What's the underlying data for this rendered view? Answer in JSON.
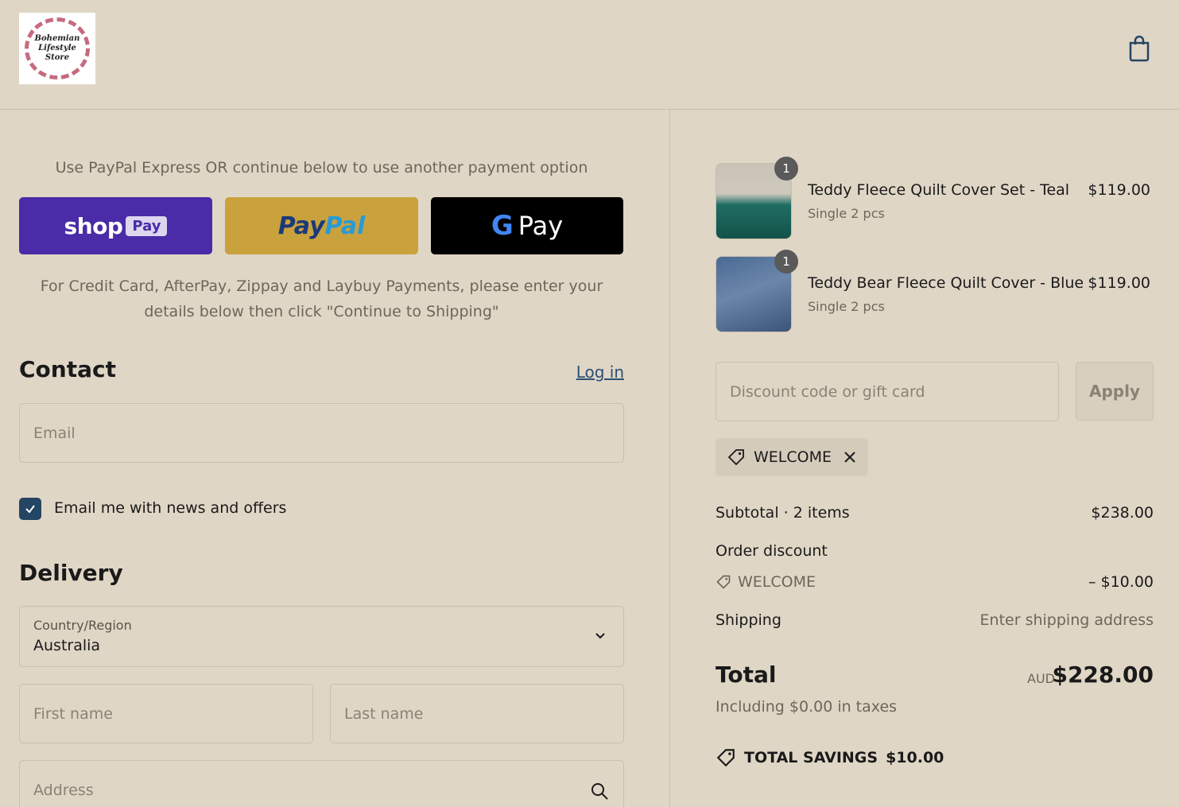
{
  "store": {
    "logo_text": "Bohemian Lifestyle Store"
  },
  "express": {
    "note": "Use PayPal Express OR continue below to use another payment option",
    "shop_word": "shop",
    "shop_pay": "Pay",
    "paypal_a": "Pay",
    "paypal_b": "Pal",
    "gpay_g": "G",
    "gpay_word": "Pay"
  },
  "credit_note": "For Credit Card, AfterPay, Zippay and Laybuy Payments, please enter your details below then click \"Continue to Shipping\"",
  "contact": {
    "title": "Contact",
    "login": "Log in",
    "email_placeholder": "Email",
    "newsletter_label": "Email me with news and offers",
    "newsletter_checked": true
  },
  "delivery": {
    "title": "Delivery",
    "country_label": "Country/Region",
    "country_value": "Australia",
    "first_name_placeholder": "First name",
    "last_name_placeholder": "Last name",
    "address_placeholder": "Address"
  },
  "cart": {
    "items": [
      {
        "name": "Teddy Fleece Quilt Cover Set - Teal",
        "variant": "Single 2 pcs",
        "price": "$119.00",
        "qty": "1"
      },
      {
        "name": "Teddy Bear Fleece Quilt Cover - Blue",
        "variant": "Single 2 pcs",
        "price": "$119.00",
        "qty": "1"
      }
    ]
  },
  "discount": {
    "placeholder": "Discount code or gift card",
    "apply": "Apply",
    "applied_code": "WELCOME"
  },
  "summary": {
    "subtotal_label": "Subtotal · 2 items",
    "subtotal_value": "$238.00",
    "order_discount_label": "Order discount",
    "discount_code": "WELCOME",
    "discount_value": "– $10.00",
    "shipping_label": "Shipping",
    "shipping_value": "Enter shipping address",
    "total_label": "Total",
    "currency": "AUD",
    "total_value": "$228.00",
    "taxes": "Including $0.00 in taxes",
    "savings_label": "TOTAL SAVINGS",
    "savings_value": "$10.00"
  },
  "colors": {
    "background": "#e0d6c6",
    "shop_pay": "#4a2ba8",
    "paypal": "#c9a23e",
    "checkbox": "#244563",
    "link": "#2c4f74"
  }
}
